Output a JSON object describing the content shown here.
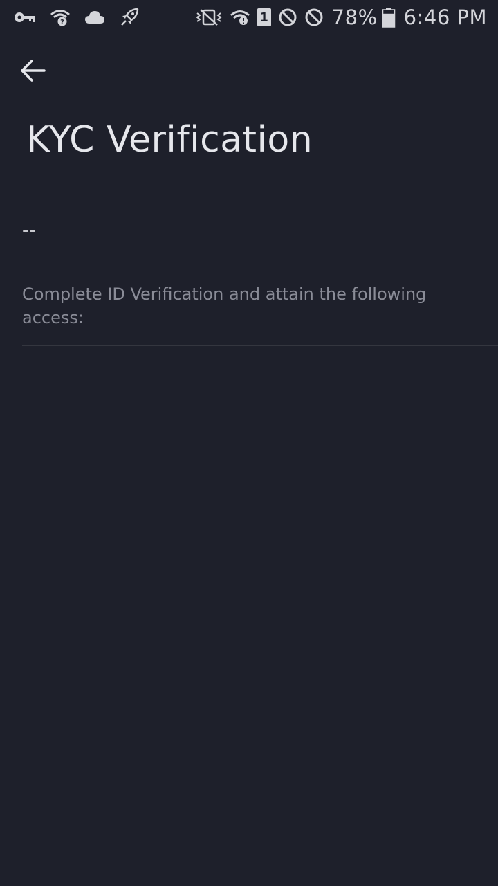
{
  "status_bar": {
    "left_icons": [
      "key-icon",
      "wifi-question-icon",
      "cloud-icon",
      "rocket-icon"
    ],
    "right_icons": [
      "vibrate-mute-icon",
      "wifi-icon",
      "sim-icon",
      "block-icon",
      "block-icon"
    ],
    "sim_label": "1",
    "battery_percent": "78%",
    "battery_level": 0.78,
    "time": "6:46 PM"
  },
  "header": {
    "back_icon": "arrow-left-icon",
    "title": "KYC Verification"
  },
  "main": {
    "status_value": "--",
    "description": "Complete ID Verification and attain the following access:"
  },
  "colors": {
    "background": "#1e202b",
    "title": "#e6e7ec",
    "muted_text": "#8a8c97",
    "divider": "#34363f"
  }
}
